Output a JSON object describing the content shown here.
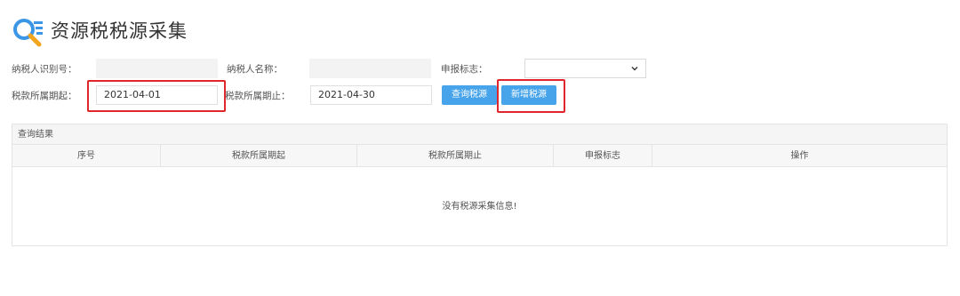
{
  "page": {
    "title": "资源税税源采集"
  },
  "form": {
    "taxpayer_id_label": "纳税人识别号：",
    "taxpayer_name_label": "纳税人名称：",
    "declare_flag_label": "申报标志：",
    "declare_flag_value": "",
    "period_start_label": "税款所属期起：",
    "period_start_value": "2021-04-01",
    "period_end_label": "税款所属期止：",
    "period_end_value": "2021-04-30"
  },
  "buttons": {
    "query_label": "查询税源",
    "add_label": "新增税源"
  },
  "results": {
    "title": "查询结果",
    "columns": [
      "序号",
      "税款所属期起",
      "税款所属期止",
      "申报标志",
      "操作"
    ],
    "empty_message": "没有税源采集信息!"
  },
  "colors": {
    "accent": "#47a4ea",
    "highlight": "#e0262b"
  }
}
